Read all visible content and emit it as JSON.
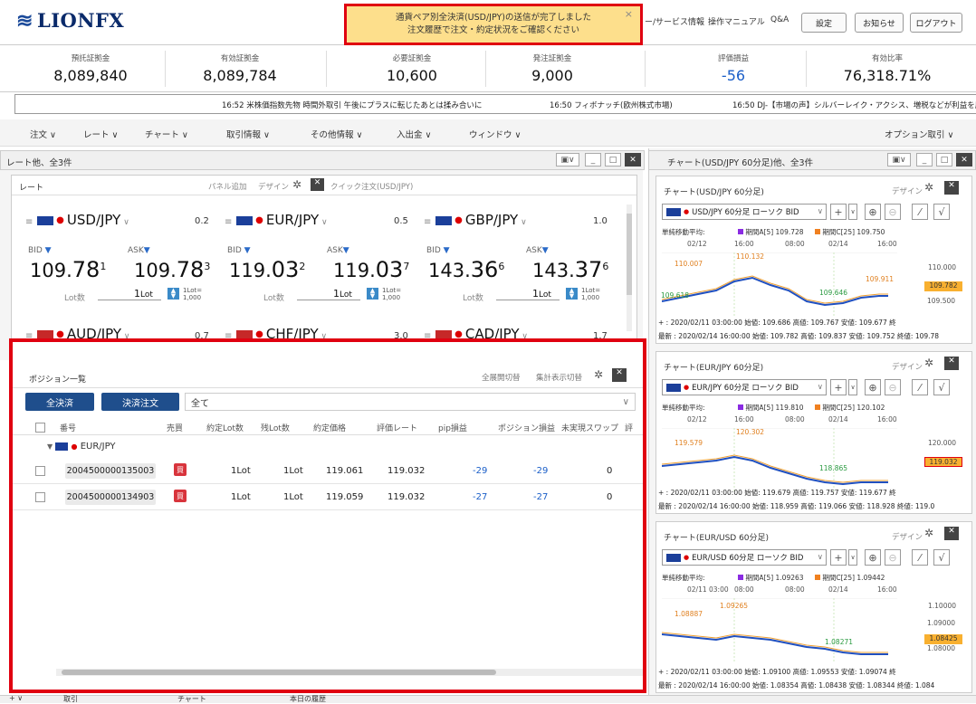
{
  "app": {
    "logo": "LIONFX"
  },
  "topnav": {
    "service": "ー/サービス情報",
    "manual": "操作マニュアル",
    "qa": "Q&A",
    "settings": "設定",
    "notice": "お知らせ",
    "logout": "ログアウト"
  },
  "toast": {
    "line1": "通貨ペア別全決済(USD/JPY)の送信が完了しました",
    "line2": "注文履歴で注文・約定状況をご確認ください",
    "close": "×"
  },
  "summary": [
    {
      "label": "預託証拠金",
      "value": "8,089,840"
    },
    {
      "label": "有効証拠金",
      "value": "8,089,784"
    },
    {
      "label": "必要証拠金",
      "value": "10,600"
    },
    {
      "label": "発注証拠金",
      "value": "9,000"
    },
    {
      "label": "評価損益",
      "value": "-56"
    },
    {
      "label": "有効比率",
      "value": "76,318.71%"
    }
  ],
  "ticker": [
    "16:52  米株価指数先物  時間外取引 午後にプラスに転じたあとは揉み合いに",
    "16:50  フィボナッチ(欧州株式市場)",
    "16:50  DJ-【市場の声】シルバーレイク・アクシス、増税などが利益を圧迫"
  ],
  "menu": [
    "注文 ∨",
    "レート ∨",
    "チャート ∨",
    "取引情報 ∨",
    "その他情報 ∨",
    "入出金 ∨",
    "ウィンドウ ∨",
    "オプション取引 ∨"
  ],
  "ratePanel": {
    "title": "レート他、全3件",
    "tab": "レート",
    "panelAdd": "パネル追加",
    "design": "デザイン",
    "quickOrder": "クイック注文(USD/JPY)",
    "bidLabel": "BID",
    "askLabel": "ASK",
    "lotLabel": "Lot数",
    "lotValue": "1",
    "lotUnit": "Lot",
    "lotRatio": "1Lot=",
    "lotRatio2": "1,000",
    "pairs": [
      {
        "name": "USD/JPY",
        "spread": "0.2",
        "bid_main": "109.",
        "bid_big": "78",
        "bid_sup": "1",
        "ask_main": "109.",
        "ask_big": "78",
        "ask_sup": "3"
      },
      {
        "name": "EUR/JPY",
        "spread": "0.5",
        "bid_main": "119.",
        "bid_big": "03",
        "bid_sup": "2",
        "ask_main": "119.",
        "ask_big": "03",
        "ask_sup": "7"
      },
      {
        "name": "GBP/JPY",
        "spread": "1.0",
        "bid_main": "143.",
        "bid_big": "36",
        "bid_sup": "6",
        "ask_main": "143.",
        "ask_big": "37",
        "ask_sup": "6"
      }
    ],
    "pairs2": [
      {
        "name": "AUD/JPY",
        "spread": "0.7"
      },
      {
        "name": "CHF/JPY",
        "spread": "3.0"
      },
      {
        "name": "CAD/JPY",
        "spread": "1.7"
      }
    ]
  },
  "positions": {
    "title": "ポジション一覧",
    "expandAll": "全展開切替",
    "totalToggle": "集計表示切替",
    "closeAll": "全決済",
    "closeOrder": "決済注文",
    "filter": "全て",
    "columns": [
      "番号",
      "売買",
      "約定Lot数",
      "残Lot数",
      "約定価格",
      "評価レート",
      "pip損益",
      "ポジション損益",
      "未実現スワップ",
      "評"
    ],
    "group": "EUR/JPY",
    "rows": [
      {
        "id": "2004500000135003",
        "side": "買",
        "lot": "1Lot",
        "remain": "1Lot",
        "price": "119.061",
        "rate": "119.032",
        "pip": "-29",
        "pl": "-29",
        "swap": "0"
      },
      {
        "id": "2004500000134903",
        "side": "買",
        "lot": "1Lot",
        "remain": "1Lot",
        "price": "119.059",
        "rate": "119.032",
        "pip": "-27",
        "pl": "-27",
        "swap": "0"
      }
    ]
  },
  "chartPanel": {
    "title": "チャート(USD/JPY 60分足)他、全3件",
    "design": "デザイン",
    "charts": [
      {
        "title": "チャート(USD/JPY 60分足)",
        "select": "USD/JPY 60分足 ローソク BID",
        "ma": "単純移動平均:",
        "maA": "期間A[5] 109.728",
        "maC": "期間C[25] 109.750",
        "times": [
          "02/12",
          "16:00",
          "08:00",
          "02/14",
          "16:00"
        ],
        "hi": "110.132",
        "hi2": "110.007",
        "r": "109.911",
        "lo": "109.646",
        "lo2": "109.618",
        "axis1": "110.000",
        "cur": "109.782",
        "axis2": "109.500",
        "ohlc1": "+ : 2020/02/11 03:00:00 始値: 109.686 高値: 109.767 安値: 109.677 終",
        "ohlc2": "最新 : 2020/02/14 16:00:00 始値: 109.782 高値: 109.837 安値: 109.752 終値: 109.78"
      },
      {
        "title": "チャート(EUR/JPY 60分足)",
        "select": "EUR/JPY 60分足 ローソク BID",
        "ma": "単純移動平均:",
        "maA": "期間A[5] 119.810",
        "maC": "期間C[25] 120.102",
        "times": [
          "02/12",
          "16:00",
          "08:00",
          "02/14",
          "16:00"
        ],
        "hi": "120.302",
        "hi2": "119.579",
        "lo": "118.865",
        "axis1": "120.000",
        "cur": "119.032",
        "ohlc1": "+ : 2020/02/11 03:00:00 始値: 119.679 高値: 119.757 安値: 119.677 終",
        "ohlc2": "最新 : 2020/02/14 16:00:00 始値: 118.959 高値: 119.066 安値: 118.928 終値: 119.0"
      },
      {
        "title": "チャート(EUR/USD 60分足)",
        "select": "EUR/USD 60分足 ローソク BID",
        "ma": "単純移動平均:",
        "maA": "期間A[5] 1.09263",
        "maC": "期間C[25] 1.09442",
        "times": [
          "02/11 03:00",
          "08:00",
          "08:00",
          "02/14",
          "16:00"
        ],
        "hi": "1.09265",
        "hi2": "1.08887",
        "lo": "1.08271",
        "axis1": "1.10000",
        "axis2": "1.09000",
        "cur": "1.08425",
        "axis3": "1.08000",
        "ohlc1": "+ : 2020/02/11 03:00:00 始値: 1.09100 高値: 1.09553 安値: 1.09074 終",
        "ohlc2": "最新 : 2020/02/14 16:00:00 始値: 1.08354 高値: 1.08438 安値: 1.08344 終値: 1.084"
      }
    ]
  },
  "bottomTabs": [
    "+ ∨",
    "取引",
    "チャート",
    "本日の履歴"
  ]
}
